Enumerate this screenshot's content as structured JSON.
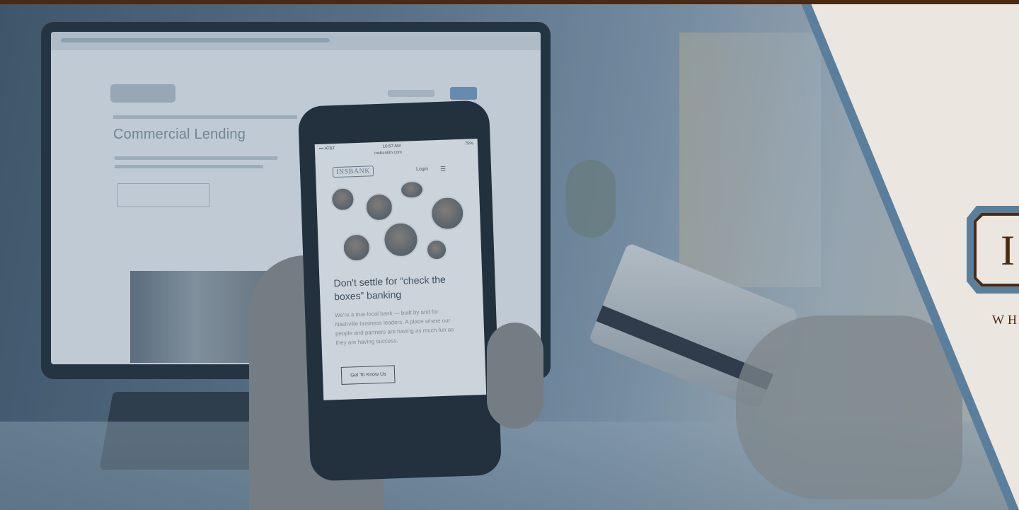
{
  "phone_screen": {
    "status_left": "••• AT&T",
    "status_time": "10:57 AM",
    "status_right": "75%",
    "url": "insbanktn.com",
    "logo_text": "INSBANK",
    "login_label": "Login",
    "menu_icon": "hamburger-icon",
    "heading": "Don't settle for “check the boxes” banking",
    "body": "We're a true local bank — built by and for Nashville business leaders. A place where our people and partners are having as much fun as they are having success.",
    "cta_label": "Get To Know Us"
  },
  "laptop_screen": {
    "heading": "Commercial Lending"
  },
  "brand_panel": {
    "logo_letter": "I",
    "tagline": "WH"
  },
  "colors": {
    "brand_brown": "#4a2a12",
    "brand_blue": "#5a7f9c",
    "panel_bg": "#ece6e0"
  }
}
